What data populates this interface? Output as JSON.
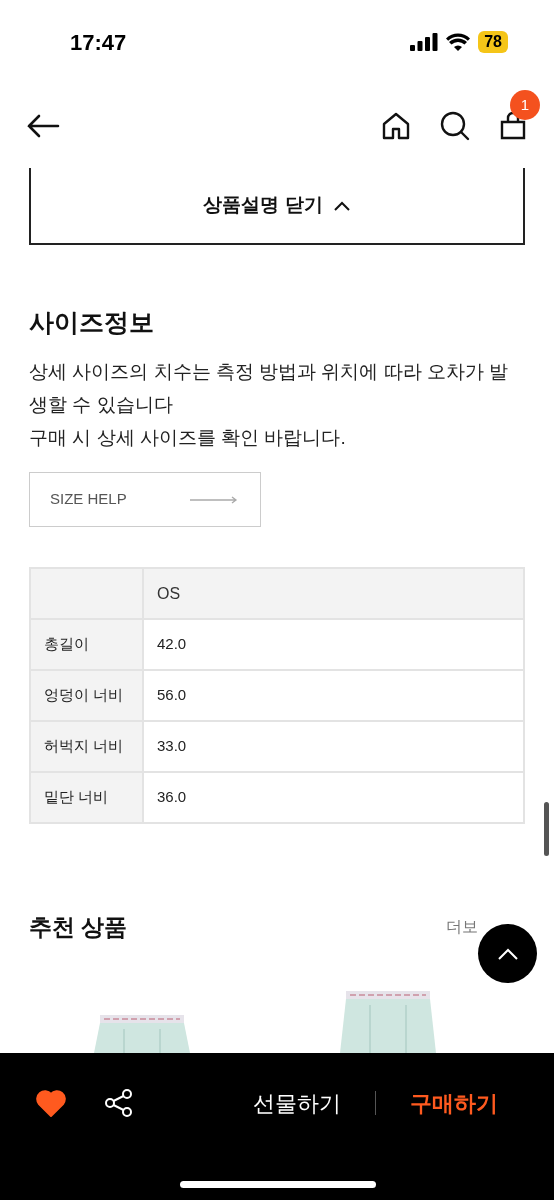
{
  "status_bar": {
    "time": "17:47",
    "battery": "78"
  },
  "nav": {
    "cart_count": "1"
  },
  "toggle_button": {
    "label": "상품설명 닫기",
    "expanded": true
  },
  "size_info": {
    "title": "사이즈정보",
    "description": [
      "상세 사이즈의 치수는 측정 방법과 위치에 따라 오차가 발생할 수 있습니다",
      "구매 시 상세 사이즈를 확인 바랍니다."
    ],
    "size_help": "SIZE HELP"
  },
  "size_table": {
    "columns": [
      "",
      "OS"
    ],
    "rows": [
      [
        "총길이",
        "42.0"
      ],
      [
        "엉덩이 너비",
        "56.0"
      ],
      [
        "허벅지 너비",
        "33.0"
      ],
      [
        "밑단 너비",
        "36.0"
      ]
    ]
  },
  "recommended": {
    "title": "추천 상품",
    "more": "더보"
  },
  "bottom_bar": {
    "liked": true,
    "gift": "선물하기",
    "buy": "구매하기"
  }
}
